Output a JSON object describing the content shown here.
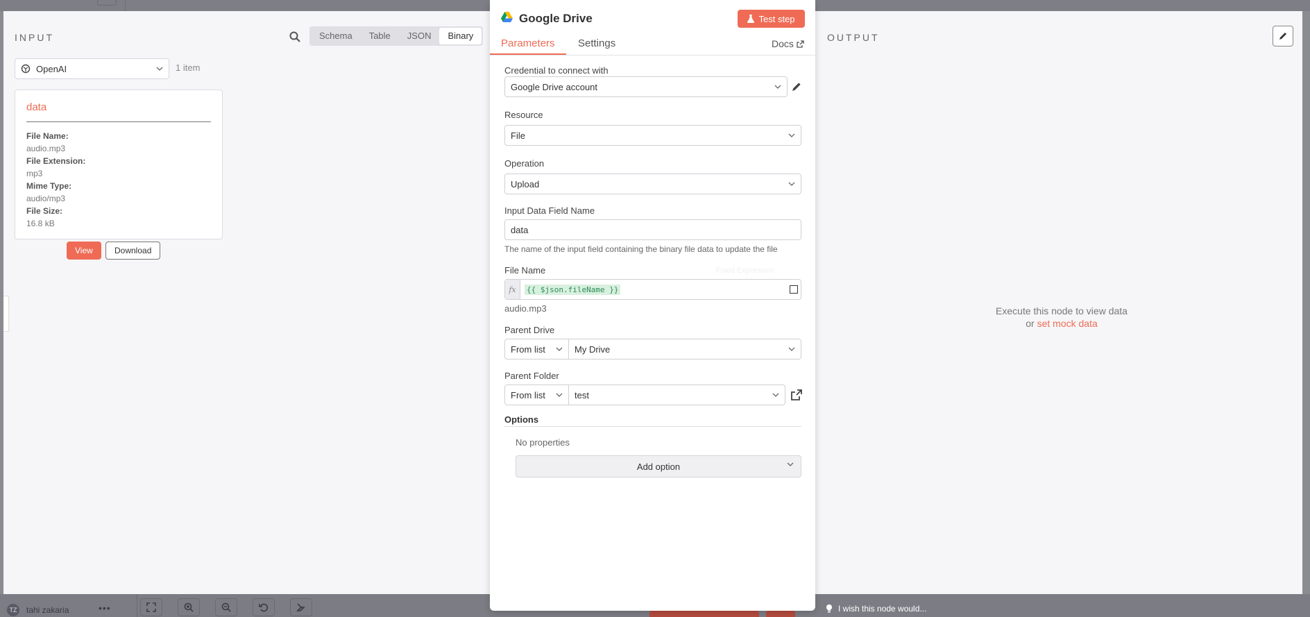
{
  "input": {
    "title": "INPUT",
    "tabs": [
      {
        "label": "Schema",
        "active": false
      },
      {
        "label": "Table",
        "active": false
      },
      {
        "label": "JSON",
        "active": false
      },
      {
        "label": "Binary",
        "active": true
      }
    ],
    "source_select": "OpenAI",
    "item_count": "1 item",
    "card": {
      "title": "data",
      "fields": [
        {
          "key": "File Name:",
          "value": "audio.mp3"
        },
        {
          "key": "File Extension:",
          "value": "mp3"
        },
        {
          "key": "Mime Type:",
          "value": "audio/mp3"
        },
        {
          "key": "File Size:",
          "value": "16.8 kB"
        }
      ],
      "view_label": "View",
      "download_label": "Download"
    }
  },
  "node": {
    "title": "Google Drive",
    "test_step_label": "Test step",
    "tabs": {
      "parameters": "Parameters",
      "settings": "Settings"
    },
    "docs_label": "Docs",
    "credential_label": "Credential to connect with",
    "credential_value": "Google Drive account",
    "resource_label": "Resource",
    "resource_value": "File",
    "operation_label": "Operation",
    "operation_value": "Upload",
    "input_field_label": "Input Data Field Name",
    "input_field_value": "data",
    "input_field_hint": "The name of the input field containing the binary file data to update the file",
    "file_name_label": "File Name",
    "file_name_mode_faint": "Fixed  Expression",
    "fx_label": "fx",
    "file_name_expression": "{{ $json.fileName }}",
    "file_name_result": "audio.mp3",
    "parent_drive_label": "Parent Drive",
    "parent_drive_mode": "From list",
    "parent_drive_value": "My Drive",
    "parent_folder_label": "Parent Folder",
    "parent_folder_mode": "From list",
    "parent_folder_value": "test",
    "options_label": "Options",
    "no_properties": "No properties",
    "add_option_label": "Add option"
  },
  "output": {
    "title": "OUTPUT",
    "message_line1": "Execute this node to view data",
    "message_or": "or ",
    "mock_link": "set mock data"
  },
  "footer": {
    "user_initials": "TZ",
    "user_name": "tahi zakaria",
    "wish_text": "I wish this node would..."
  },
  "colors": {
    "accent": "#ef6b55",
    "expression_green": "#2e8b57"
  }
}
